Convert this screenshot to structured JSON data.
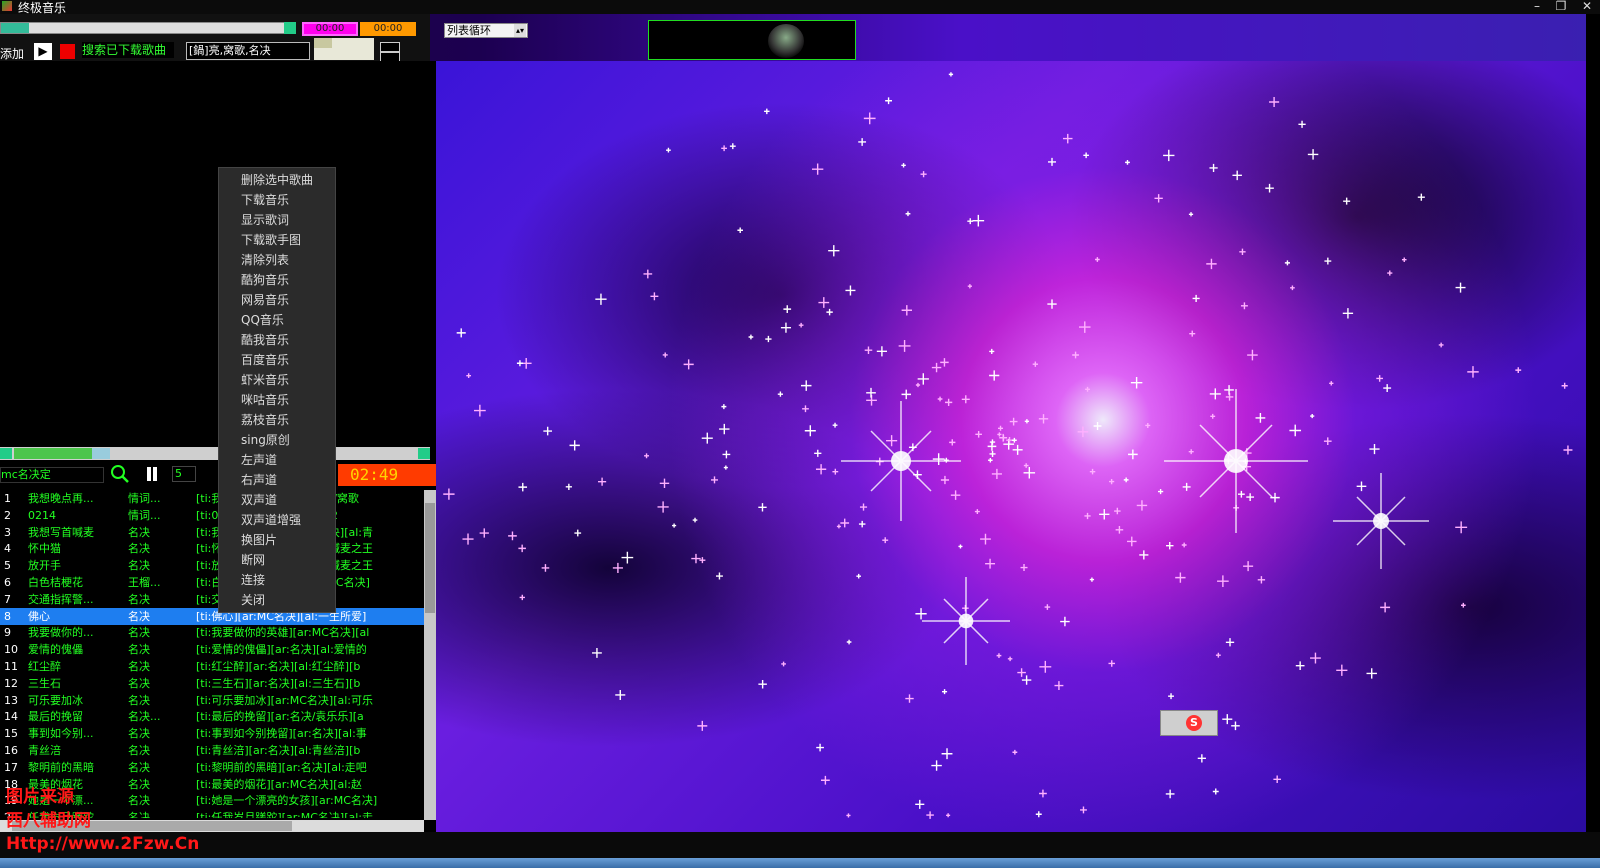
{
  "app": {
    "title": "终极音乐"
  },
  "window": {
    "minimize": "–",
    "restore": "❐",
    "close": "✕"
  },
  "toolbar": {
    "time_elapsed": "00:00",
    "time_total": "00:00",
    "play_mode": "列表循环",
    "add_label": "添加",
    "play_icon": "▶",
    "search_downloaded": "搜索已下载歌曲",
    "search_value": "[鍋]亮,窝歌,名决"
  },
  "controls": {
    "now_playing": "mc名决定",
    "count": "5",
    "timer": "02:49"
  },
  "context_menu": {
    "items": [
      "删除选中歌曲",
      "下载音乐",
      "显示歌词",
      "下载歌手图",
      "清除列表",
      "酷狗音乐",
      "网易音乐",
      "QQ音乐",
      "酷我音乐",
      "百度音乐",
      "虾米音乐",
      "咪咕音乐",
      "荔枝音乐",
      "sing原创",
      "左声道",
      "右声道",
      "双声道",
      "双声道增强",
      "换图片",
      "断网",
      "连接",
      "关闭"
    ]
  },
  "playlist": {
    "rows": [
      {
        "n": "1",
        "title": "我想晚点再...",
        "artist": "情词...",
        "meta": "[ti:我想晚点再...][ar:情词亮/窝歌"
      },
      {
        "n": "2",
        "title": "0214",
        "artist": "情词...",
        "meta": "[ti:0214][ar:MC名决][al:02"
      },
      {
        "n": "3",
        "title": "我想写首喊麦",
        "artist": "名决",
        "meta": "[ti:我想写首喊麦][ar:MC名决][al:青"
      },
      {
        "n": "4",
        "title": "怀中猫",
        "artist": "名决",
        "meta": "[ti:怀中猫][ar:MC名决][al:喊麦之王"
      },
      {
        "n": "5",
        "title": "放开手",
        "artist": "名决",
        "meta": "[ti:放开手][ar:MC名决][al:喊麦之王"
      },
      {
        "n": "6",
        "title": "白色桔梗花",
        "artist": "王榴...",
        "meta": "[ti:白色桔梗花][ar:王榴天/MC名决]"
      },
      {
        "n": "7",
        "title": "交通指挥警...",
        "artist": "名决",
        "meta": "[ti:交通指挥警曲][by:][off"
      },
      {
        "n": "8",
        "title": "佛心",
        "artist": "名决",
        "meta": "[ti:佛心][ar:MC名决][al:一生所爱]",
        "selected": true
      },
      {
        "n": "9",
        "title": "我要做你的...",
        "artist": "名决",
        "meta": "[ti:我要做你的英雄][ar:MC名决][al"
      },
      {
        "n": "10",
        "title": "爱情的傀儡",
        "artist": "名决",
        "meta": "[ti:爱情的傀儡][ar:名决][al:爱情的"
      },
      {
        "n": "11",
        "title": "红尘醉",
        "artist": "名决",
        "meta": "[ti:红尘醉][ar:名决][al:红尘醉][b"
      },
      {
        "n": "12",
        "title": "三生石",
        "artist": "名决",
        "meta": "[ti:三生石][ar:名决][al:三生石][b"
      },
      {
        "n": "13",
        "title": "可乐要加冰",
        "artist": "名决",
        "meta": "[ti:可乐要加冰][ar:MC名决][al:可乐"
      },
      {
        "n": "14",
        "title": "最后的挽留",
        "artist": "名决...",
        "meta": "[ti:最后的挽留][ar:名决/袁乐乐][a"
      },
      {
        "n": "15",
        "title": "事到如今别...",
        "artist": "名决",
        "meta": "[ti:事到如今别挽留][ar:名决][al:事"
      },
      {
        "n": "16",
        "title": "青丝涪",
        "artist": "名决",
        "meta": "[ti:青丝涪][ar:名决][al:青丝涪][b"
      },
      {
        "n": "17",
        "title": "黎明前的黑暗",
        "artist": "名决",
        "meta": "[ti:黎明前的黑暗][ar:名决][al:走吧"
      },
      {
        "n": "18",
        "title": "最美的烟花",
        "artist": "名决",
        "meta": "[ti:最美的烟花][ar:MC名决][al:赵"
      },
      {
        "n": "19",
        "title": "她是一个漂...",
        "artist": "名决",
        "meta": "[ti:她是一个漂亮的女孩][ar:MC名决]"
      },
      {
        "n": "20",
        "title": "任我岁月蹉跎",
        "artist": "名决",
        "meta": "[ti:任我岁月蹉跎][ar:MC名决][al:走"
      }
    ]
  },
  "watermark": {
    "line1": "图片来源",
    "line2": "西八辅助网",
    "line3": "Http://www.2Fzw.Cn"
  },
  "ime": {
    "logo": "S"
  },
  "colors": {
    "accent_green": "#22ff22",
    "selected_row": "#1e7ef0",
    "timer_bg": "#ff3b00",
    "timer_fg": "#ffd400",
    "watermark": "#ff1818"
  }
}
